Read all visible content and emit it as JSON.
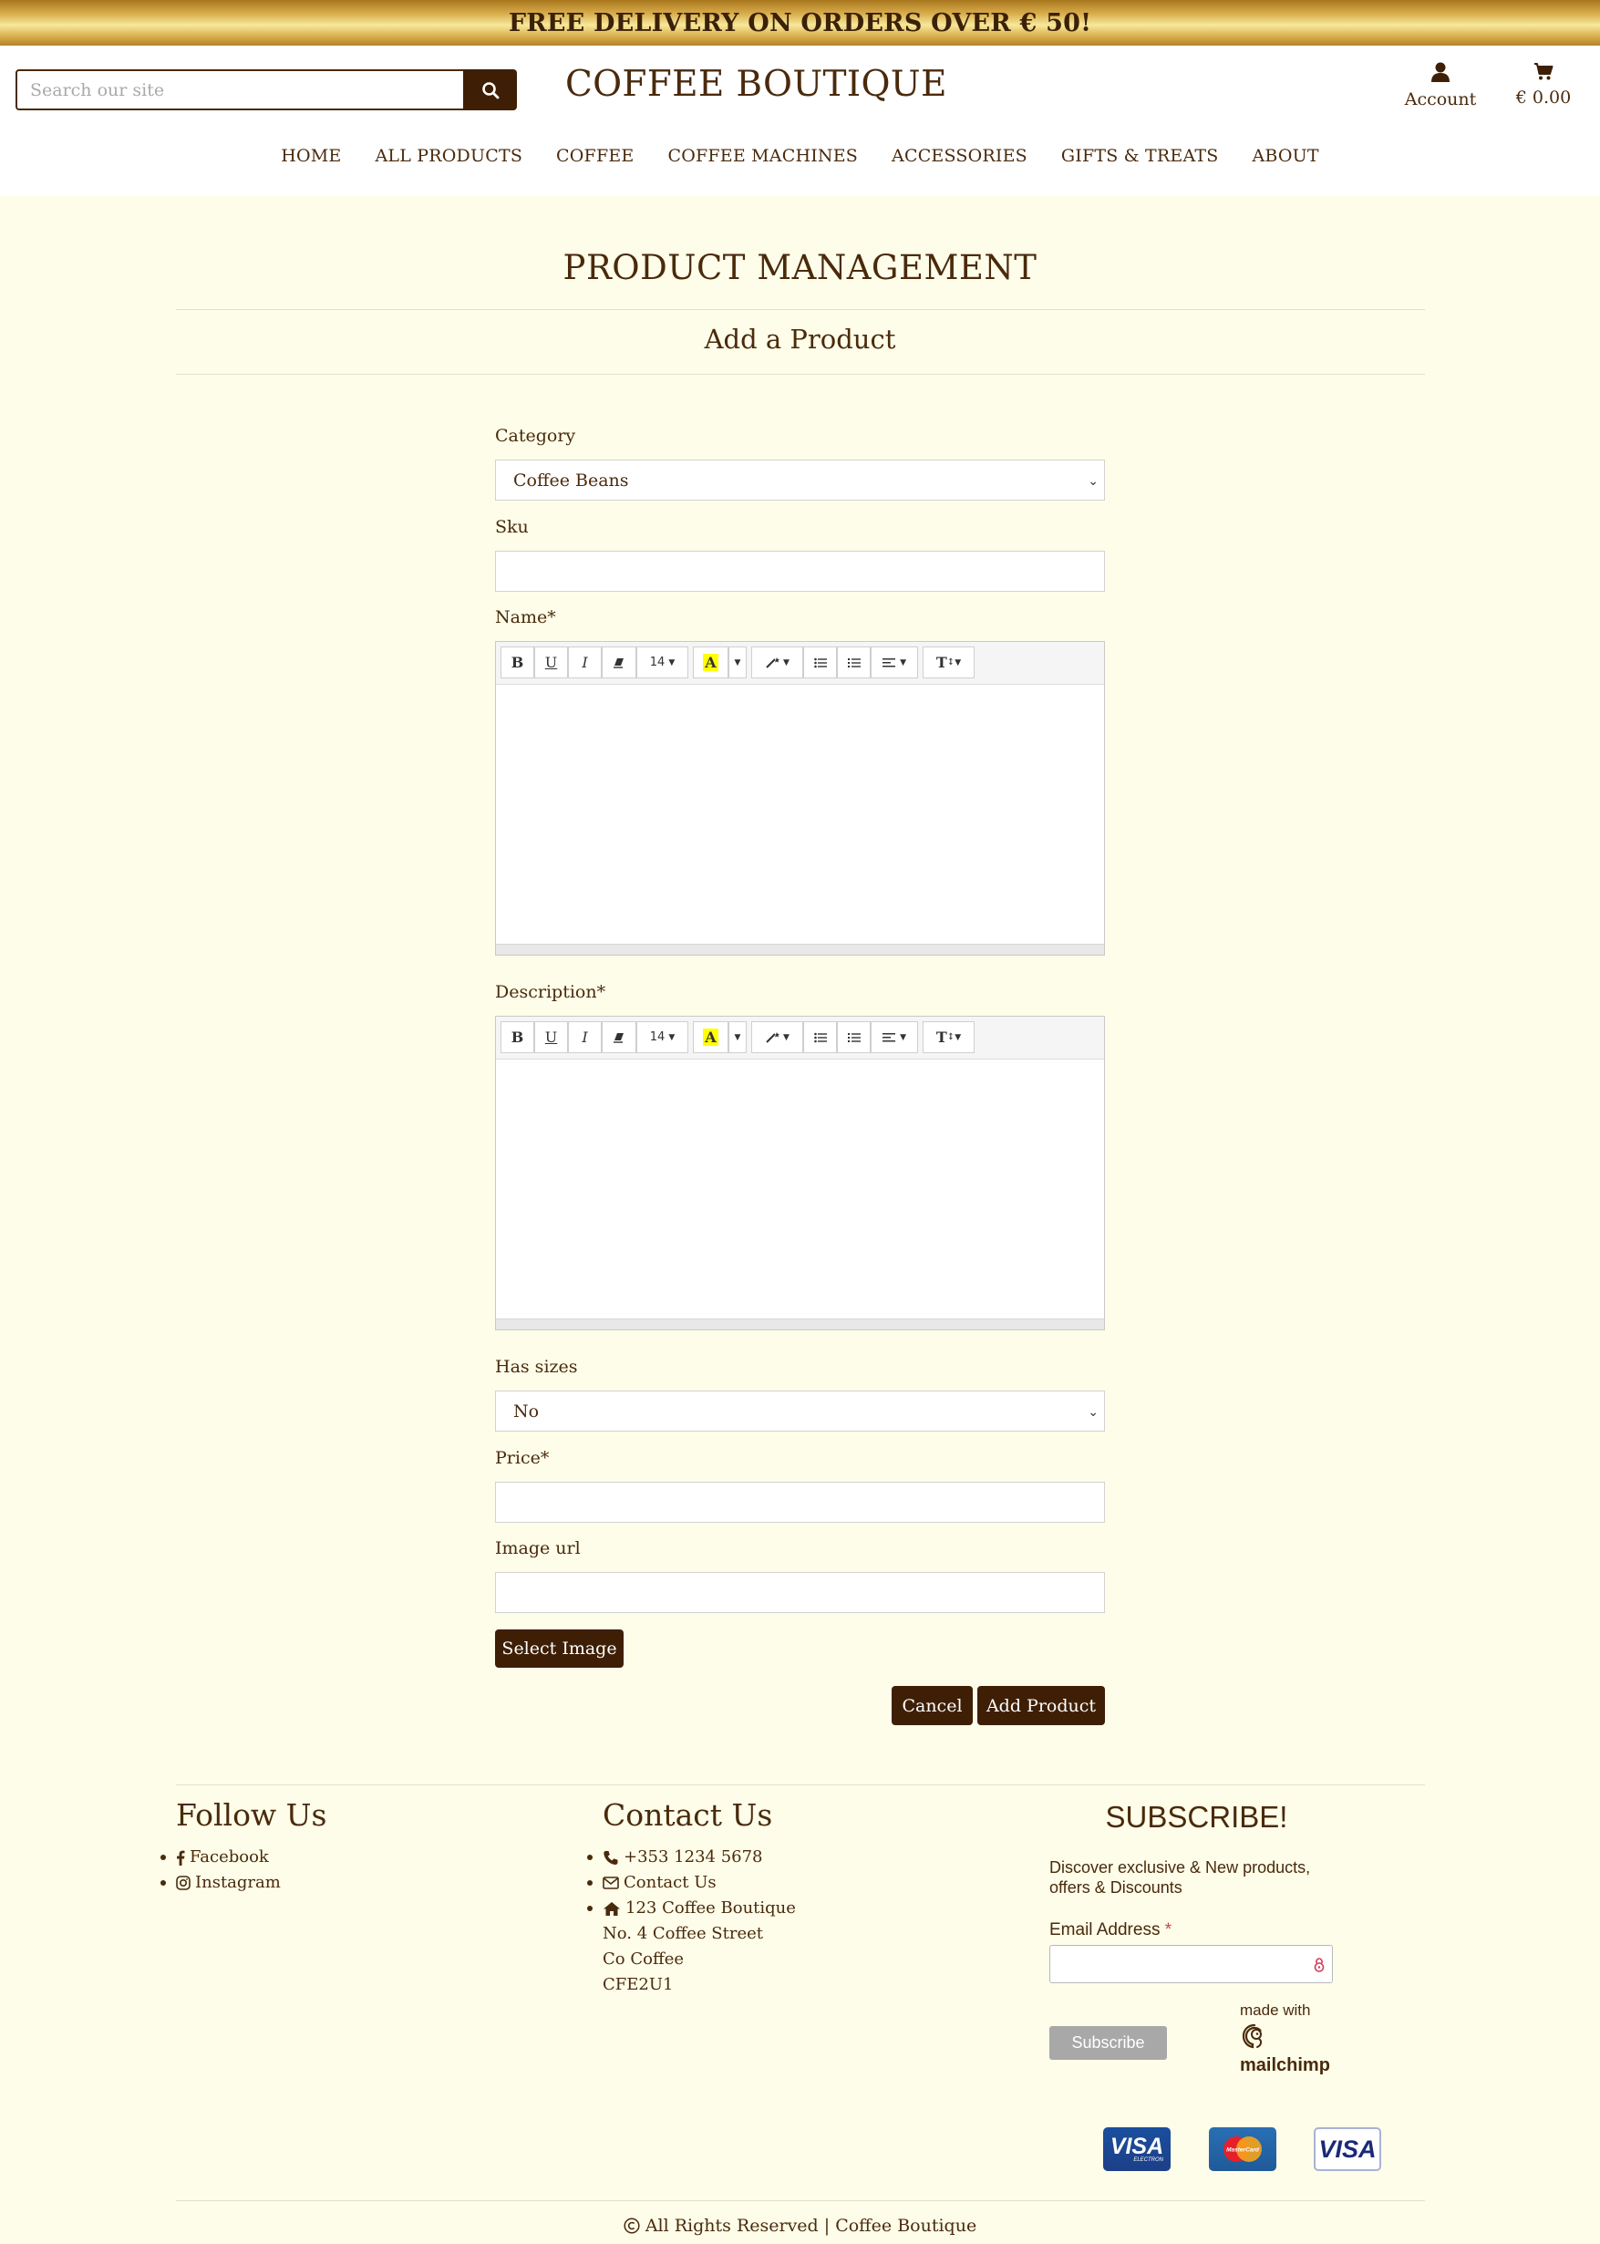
{
  "banner": {
    "text": "FREE DELIVERY ON ORDERS OVER € 50!"
  },
  "header": {
    "search_placeholder": "Search our site",
    "brand": "COFFEE BOUTIQUE",
    "account_label": "Account",
    "cart_total": "€ 0.00"
  },
  "nav": [
    "HOME",
    "ALL PRODUCTS",
    "COFFEE",
    "COFFEE MACHINES",
    "ACCESSORIES",
    "GIFTS & TREATS",
    "ABOUT"
  ],
  "page": {
    "title": "PRODUCT MANAGEMENT",
    "subtitle": "Add a Product"
  },
  "form": {
    "category_label": "Category",
    "category_value": "Coffee Beans",
    "sku_label": "Sku",
    "sku_value": "",
    "name_label": "Name*",
    "description_label": "Description*",
    "has_sizes_label": "Has sizes",
    "has_sizes_value": "No",
    "price_label": "Price*",
    "price_value": "",
    "image_url_label": "Image url",
    "image_url_value": "",
    "select_image_label": "Select Image",
    "cancel_label": "Cancel",
    "submit_label": "Add Product"
  },
  "editor_toolbar": {
    "bold": "B",
    "underline": "U",
    "italic": "I",
    "font_size": "14",
    "color": "A",
    "style": "T",
    "icons": [
      "bold-icon",
      "underline-icon",
      "italic-icon",
      "eraser-icon",
      "font-size-dropdown",
      "text-color-icon",
      "magic-icon",
      "unordered-list-icon",
      "ordered-list-icon",
      "align-icon",
      "text-height-icon"
    ]
  },
  "footer": {
    "follow_title": "Follow Us",
    "follow_links": [
      "Facebook",
      "Instagram"
    ],
    "contact_title": "Contact Us",
    "phone": "+353 1234 5678",
    "contact_link": "Contact Us",
    "address": [
      "123 Coffee Boutique",
      "No. 4 Coffee Street",
      "Co Coffee",
      "CFE2U1"
    ],
    "subscribe_title": "SUBSCRIBE!",
    "subscribe_text": "Discover exclusive & New products, offers & Discounts",
    "email_label": "Email Address",
    "email_required": "*",
    "subscribe_button": "Subscribe",
    "made_with": "made with",
    "mailchimp": "mailchimp",
    "cards": [
      "VISA",
      "MasterCard",
      "VISA"
    ],
    "card_sub": "ELECTRON",
    "copyright": "All Rights Reserved | Coffee Boutique"
  },
  "colors": {
    "brand_dark": "#3e1f06",
    "text": "#4a2a0c",
    "page_bg": "#fdfde9",
    "gold": "#d9ad4c"
  }
}
